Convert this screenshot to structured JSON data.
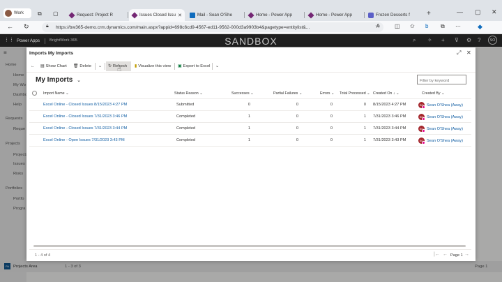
{
  "browser": {
    "profile": "Work",
    "tabs": [
      {
        "label": "Request: Project R"
      },
      {
        "label": "Issues Closed Issu"
      },
      {
        "label": "Mail - Sean O'She"
      },
      {
        "label": "Home - Power App"
      },
      {
        "label": "Home - Power App"
      },
      {
        "label": "Frozen Desserts f"
      }
    ],
    "url": "https://bw365-demo.crm.dynamics.com/main.aspx?appid=698c6cd9-4567-ed11-9562-000d3a9903b4&pagetype=entitylist&..."
  },
  "app": {
    "product": "Power Apps",
    "app_name": "BrightWork 365",
    "environment": "SANDBOX",
    "user_initials": "SO",
    "nav": [
      {
        "label": "Home"
      },
      {
        "label": "Home"
      },
      {
        "label": "My Wo"
      },
      {
        "label": "Dashbo"
      },
      {
        "label": "Help"
      },
      {
        "label": "Requests"
      },
      {
        "label": "Reque"
      },
      {
        "label": "Projects"
      },
      {
        "label": "Projects"
      },
      {
        "label": "Issues"
      },
      {
        "label": "Risks"
      },
      {
        "label": "Portfolios"
      },
      {
        "label": "Portfo"
      },
      {
        "label": "Progra"
      }
    ],
    "area": "Projects Area",
    "area_initials": "PA",
    "bg_record_count": "1 - 3 of 3",
    "bg_page": "Page 1"
  },
  "dialog": {
    "title": "Imports My Imports",
    "commands": {
      "show_chart": "Show Chart",
      "delete": "Delete",
      "refresh": "Refresh",
      "visualize": "Visualize this view",
      "export": "Export to Excel"
    },
    "view_title": "My Imports",
    "filter_placeholder": "Filter by keyword",
    "columns": {
      "import_name": "Import Name",
      "status_reason": "Status Reason",
      "successes": "Successes",
      "partial_failures": "Partial Failures",
      "errors": "Errors",
      "total_processed": "Total Processed",
      "created_on": "Created On",
      "created_by": "Created By"
    },
    "rows": [
      {
        "name": "Excel Online - Closed Issues 8/15/2023 4:27 PM",
        "status": "Submitted",
        "successes": "0",
        "partial": "0",
        "errors": "0",
        "total": "0",
        "created_on": "8/15/2023 4:27 PM",
        "created_by": "Sean O'Shea (Away)",
        "initials": "SO"
      },
      {
        "name": "Excel Online - Closed Issues 7/31/2023 3:46 PM",
        "status": "Completed",
        "successes": "1",
        "partial": "0",
        "errors": "0",
        "total": "1",
        "created_on": "7/31/2023 3:46 PM",
        "created_by": "Sean O'Shea (Away)",
        "initials": "SO"
      },
      {
        "name": "Excel Online - Closed Issues 7/31/2023 3:44 PM",
        "status": "Completed",
        "successes": "1",
        "partial": "0",
        "errors": "0",
        "total": "1",
        "created_on": "7/31/2023 3:44 PM",
        "created_by": "Sean O'Shea (Away)",
        "initials": "SO"
      },
      {
        "name": "Excel Online - Open Issues 7/31/2023 3:43 PM",
        "status": "Completed",
        "successes": "1",
        "partial": "0",
        "errors": "0",
        "total": "1",
        "created_on": "7/31/2023 3:43 PM",
        "created_by": "Sean O'Shea (Away)",
        "initials": "SO"
      }
    ],
    "record_count": "1 - 4 of 4",
    "page": "Page 1"
  }
}
